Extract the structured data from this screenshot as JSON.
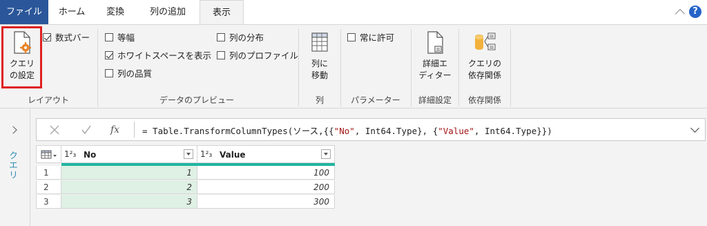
{
  "tabs": [
    {
      "label": "ファイル"
    },
    {
      "label": "ホーム"
    },
    {
      "label": "変換"
    },
    {
      "label": "列の追加"
    },
    {
      "label": "表示"
    }
  ],
  "ribbon": {
    "query_settings_label_1": "クエリ",
    "query_settings_label_2": "の設定",
    "formula_bar_label": "数式バー",
    "monospace_label": "等幅",
    "show_whitespace_label": "ホワイトスペースを表示",
    "column_quality_label": "列の品質",
    "column_distribution_label": "列の分布",
    "column_profile_label": "列のプロファイル",
    "goto_column_label_1": "列に",
    "goto_column_label_2": "移動",
    "always_allow_label": "常に許可",
    "advanced_editor_label_1": "詳細エ",
    "advanced_editor_label_2": "ディター",
    "query_dependencies_label_1": "クエリの",
    "query_dependencies_label_2": "依存関係",
    "groups": {
      "layout": "レイアウト",
      "data_preview": "データのプレビュー",
      "columns": "列",
      "parameters": "パラメーター",
      "advanced": "詳細設定",
      "dependencies": "依存関係"
    },
    "checked": {
      "formula_bar": true,
      "monospace": false,
      "show_whitespace": true,
      "column_quality": false,
      "column_distribution": false,
      "column_profile": false,
      "always_allow": false
    }
  },
  "side_panel": {
    "label": "クエリ"
  },
  "formula": {
    "prefix": "= Table.TransformColumnTypes(ソース,{{",
    "s1": "\"No\"",
    "mid1": ", Int64.Type}, {",
    "s2": "\"Value\"",
    "suffix": ", Int64.Type}})"
  },
  "table": {
    "type_glyph": "1²₃",
    "columns": [
      "No",
      "Value"
    ],
    "rows": [
      {
        "n": "1",
        "no": "1",
        "value": "100"
      },
      {
        "n": "2",
        "no": "2",
        "value": "200"
      },
      {
        "n": "3",
        "no": "3",
        "value": "300"
      }
    ]
  },
  "colors": {
    "file_tab": "#2b579a",
    "highlight_box": "#e02020",
    "teal_bar": "#1fb5a1",
    "string_literal": "#a31515",
    "selected_column": "#dff0e4"
  }
}
